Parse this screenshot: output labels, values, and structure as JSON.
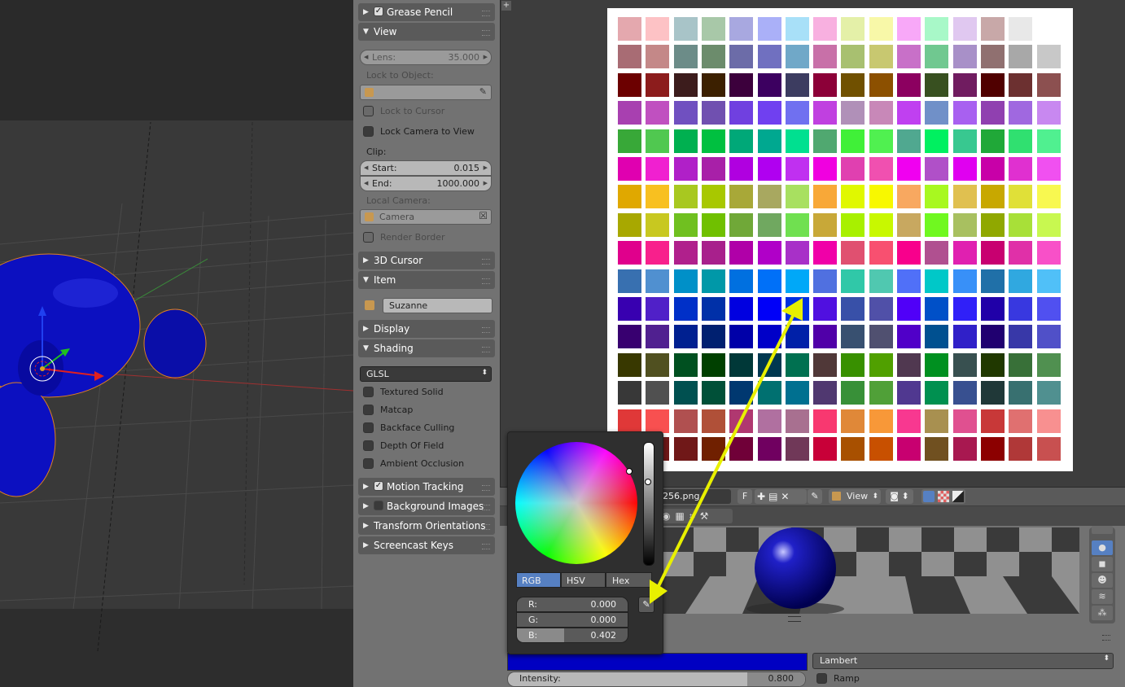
{
  "properties": {
    "grease_pencil": {
      "label": "Grease Pencil",
      "checked": true
    },
    "view": {
      "label": "View",
      "lens_label": "Lens:",
      "lens_value": "35.000",
      "lock_to_object_label": "Lock to Object:",
      "lock_to_cursor": "Lock to Cursor",
      "lock_camera_to_view": "Lock Camera to View",
      "clip_label": "Clip:",
      "clip_start_label": "Start:",
      "clip_start_value": "0.015",
      "clip_end_label": "End:",
      "clip_end_value": "1000.000",
      "local_camera_label": "Local Camera:",
      "local_camera_value": "Camera",
      "render_border": "Render Border"
    },
    "cursor_3d": {
      "label": "3D Cursor"
    },
    "item": {
      "label": "Item",
      "name": "Suzanne"
    },
    "display": {
      "label": "Display"
    },
    "shading": {
      "label": "Shading",
      "mode": "GLSL",
      "options": [
        "Textured Solid",
        "Matcap",
        "Backface Culling",
        "Depth Of Field",
        "Ambient Occlusion"
      ]
    },
    "motion_tracking": {
      "label": "Motion Tracking",
      "checked": true
    },
    "background_images": {
      "label": "Background Images",
      "checked": false
    },
    "transform_orientations": {
      "label": "Transform Orientations"
    },
    "screencast_keys": {
      "label": "Screencast Keys"
    }
  },
  "image_editor": {
    "filename": "256.png",
    "fake_user": "F",
    "view_menu": "View"
  },
  "color_picker": {
    "tabs": [
      "RGB",
      "HSV",
      "Hex"
    ],
    "active_tab": "RGB",
    "r_label": "R:",
    "r_value": "0.000",
    "g_label": "G:",
    "g_value": "0.000",
    "b_label": "B:",
    "b_value": "0.402"
  },
  "material": {
    "diffuse_color": "#0000c2",
    "shader": "Lambert",
    "intensity_label": "Intensity:",
    "intensity_value": "0.800",
    "ramp_label": "Ramp"
  },
  "colors": {
    "arrow": "#e8f000",
    "selected_tab": "#5680c2",
    "swatches": [
      [
        "#e4a8ae",
        "#fdc2c5",
        "#a8c4c8",
        "#a8c8a8",
        "#a8a8e0",
        "#aab0f8",
        "#a8e0f8",
        "#f8b0e0",
        "#e4f0a8",
        "#f8f8a8",
        "#f8a8f8",
        "#a8f8c8",
        "#e0c8f0",
        "#c8a8a8",
        "#e8e8e8",
        "#ffffff"
      ],
      [
        "#a86c74",
        "#c48888",
        "#6c8c88",
        "#6c8c6c",
        "#6c6ca8",
        "#7070c0",
        "#70a8c8",
        "#c870a8",
        "#a8c070",
        "#c8c870",
        "#c870c8",
        "#70c890",
        "#a890c8",
        "#907070",
        "#a8a8a8",
        "#c8c8c8"
      ],
      [
        "#6c0000",
        "#8c1c1c",
        "#3c1c1c",
        "#3c2000",
        "#3c003c",
        "#3c0060",
        "#3c3c60",
        "#8c0038",
        "#705000",
        "#8c5000",
        "#8c0060",
        "#385020",
        "#701c60",
        "#500000",
        "#6c3030",
        "#8c5050"
      ],
      [
        "#a840b0",
        "#c050c0",
        "#7050c0",
        "#7050b0",
        "#7040e0",
        "#7040f0",
        "#7070f0",
        "#c040e0",
        "#b090b8",
        "#c888b8",
        "#c040f0",
        "#7090c8",
        "#a860f0",
        "#9040b0",
        "#a068e0",
        "#c888f0"
      ],
      [
        "#38a838",
        "#50c850",
        "#00b050",
        "#00c040",
        "#00a878",
        "#00a890",
        "#00e090",
        "#50a870",
        "#40f038",
        "#50f050",
        "#50a890",
        "#00f060",
        "#38c890",
        "#20a838",
        "#30e070",
        "#50f090"
      ],
      [
        "#e000b0",
        "#f020d0",
        "#b020c8",
        "#a820a8",
        "#b000e0",
        "#b000f0",
        "#c030f0",
        "#f000e0",
        "#e040b0",
        "#f050b0",
        "#f000f0",
        "#b050c8",
        "#e000f0",
        "#c800a8",
        "#e030d0",
        "#f050f0"
      ],
      [
        "#e0a800",
        "#f8c020",
        "#a8c820",
        "#a8c800",
        "#a8a838",
        "#a8a860",
        "#a8e060",
        "#f8a838",
        "#e0f800",
        "#f8f800",
        "#f8a860",
        "#a8f820",
        "#e0c050",
        "#c8a800",
        "#e0e038",
        "#f8f850"
      ],
      [
        "#a8a800",
        "#c8c820",
        "#70c020",
        "#70c000",
        "#70a838",
        "#70a860",
        "#70e050",
        "#c8a838",
        "#a8f000",
        "#c8f800",
        "#c8a860",
        "#70f820",
        "#a8c060",
        "#90a800",
        "#a8e038",
        "#c8f850"
      ],
      [
        "#e0008c",
        "#f8208c",
        "#b0208c",
        "#a8208c",
        "#b000a8",
        "#b000c8",
        "#a830c8",
        "#f000a8",
        "#e05070",
        "#f85070",
        "#f8008c",
        "#b05090",
        "#e020b0",
        "#c80070",
        "#e030a8",
        "#f850c8"
      ],
      [
        "#3870b0",
        "#5090d0",
        "#0090c8",
        "#0098a8",
        "#0070e0",
        "#0070f8",
        "#00a8f8",
        "#5070e0",
        "#30c8a8",
        "#50c8b0",
        "#5070f8",
        "#00c8c8",
        "#3890f8",
        "#2070a8",
        "#30a8e0",
        "#50c0f8"
      ],
      [
        "#3800b0",
        "#5020c8",
        "#0030c8",
        "#0030a8",
        "#0000e0",
        "#0000f8",
        "#0030e0",
        "#5010e0",
        "#3850a8",
        "#5050a8",
        "#5000f8",
        "#0050c8",
        "#3020f8",
        "#2000a8",
        "#3838e0",
        "#5050f0"
      ],
      [
        "#380070",
        "#502090",
        "#002090",
        "#002070",
        "#0000a8",
        "#0000c8",
        "#0020a8",
        "#5000a8",
        "#385070",
        "#505070",
        "#5000c8",
        "#005090",
        "#3020c8",
        "#200070",
        "#3838a8",
        "#5050c8"
      ],
      [
        "#383800",
        "#505020",
        "#005020",
        "#004000",
        "#003838",
        "#003850",
        "#007050",
        "#503838",
        "#389000",
        "#50a000",
        "#503850",
        "#009020",
        "#385050",
        "#203800",
        "#387038",
        "#509050"
      ],
      [
        "#383838",
        "#505050",
        "#005050",
        "#005038",
        "#003870",
        "#007070",
        "#007090",
        "#503870",
        "#389038",
        "#50a038",
        "#503890",
        "#009050",
        "#385090",
        "#203838",
        "#387070",
        "#509090"
      ],
      [
        "#e03838",
        "#f85050",
        "#b05050",
        "#b05038",
        "#b03870",
        "#b070a0",
        "#a87090",
        "#f83870",
        "#e08838",
        "#f89838",
        "#f83890",
        "#a89050",
        "#e05090",
        "#c83838",
        "#e07070",
        "#f89090"
      ],
      [
        "#301818",
        "#701818",
        "#701818",
        "#702000",
        "#700038",
        "#700060",
        "#703858",
        "#c80038",
        "#a85000",
        "#c85000",
        "#c80070",
        "#705020",
        "#a81850",
        "#8c0000",
        "#b03838",
        "#c85050"
      ]
    ]
  }
}
